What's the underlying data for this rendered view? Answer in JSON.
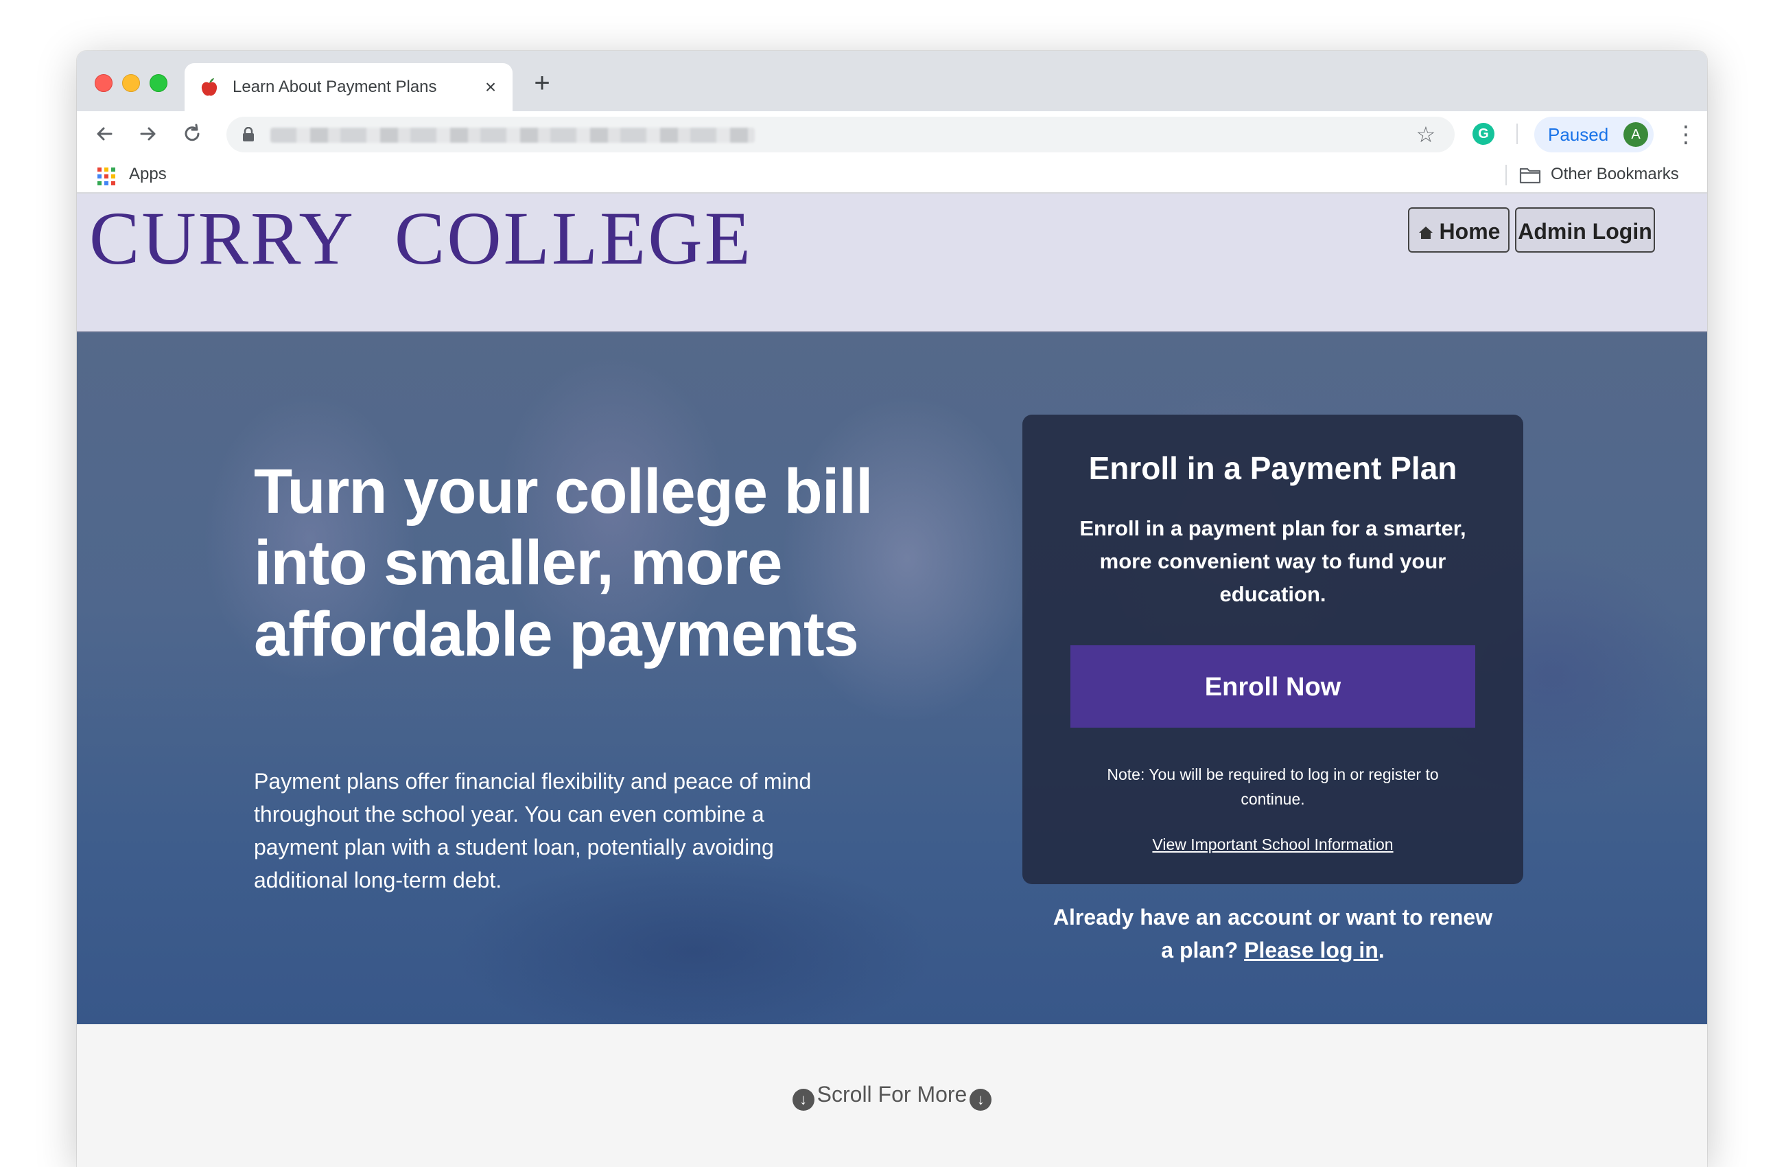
{
  "browser": {
    "tab_title": "Learn About Payment Plans",
    "tab_close_icon": "×",
    "new_tab_icon": "+",
    "profile_status": "Paused",
    "avatar_letter": "A",
    "extension_letter": "G",
    "bookmarks": {
      "apps_label": "Apps",
      "other_label": "Other Bookmarks"
    }
  },
  "site": {
    "logo": "CURRY  COLLEGE",
    "nav": {
      "home_label": "Home",
      "admin_label": "Admin Login"
    },
    "hero": {
      "headline": "Turn your college bill into smaller, more affordable payments",
      "body": "Payment plans offer financial flexibility and peace of mind throughout the school year. You can even combine a payment plan with a student loan, potentially avoiding additional long-term debt."
    },
    "enroll_card": {
      "title": "Enroll in a Payment Plan",
      "subtitle": "Enroll in a payment plan for a smarter, more convenient way to fund your education.",
      "button_label": "Enroll Now",
      "note": "Note: You will be required to log in or register to continue.",
      "info_link": "View Important School Information"
    },
    "login_prompt": {
      "text": "Already have an account or want to renew a plan?",
      "link": "Please log in",
      "suffix": "."
    },
    "scroll_label": "Scroll For More"
  },
  "colors": {
    "brand_purple": "#452c88",
    "button_purple": "#4b3594",
    "header_bg": "#dfdfed",
    "card_bg": "#222a42"
  }
}
